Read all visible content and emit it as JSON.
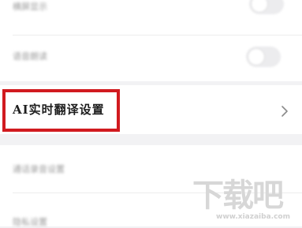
{
  "settings": {
    "row1_label": "横屏显示",
    "row2_label": "语音朗读",
    "ai_translation_label": "AI实时翻译设置",
    "row4_label": "通话录音设置",
    "row5_label": "隐私设置"
  },
  "watermark": {
    "main": "下载吧",
    "sub": "www.xiazaiba.com"
  },
  "colors": {
    "highlight": "#d11a1f",
    "background": "#f2f2f4",
    "card": "#ffffff"
  }
}
